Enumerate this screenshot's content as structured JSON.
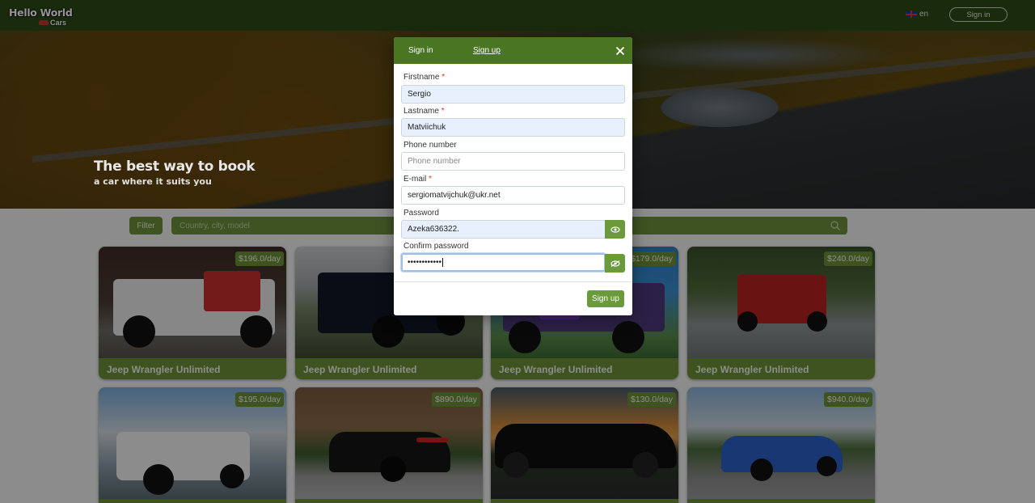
{
  "navbar": {
    "logo_main": "Hello World",
    "logo_sub": "Cars",
    "language": "en",
    "signin_label": "Sign in"
  },
  "hero": {
    "title": "The best way to book",
    "subtitle": "a car where it suits you"
  },
  "filter": {
    "button_label": "Filter",
    "search_placeholder": "Country, city, model"
  },
  "cars": [
    {
      "name": "Jeep Wrangler Unlimited",
      "price": "$196.0/day"
    },
    {
      "name": "Jeep Wrangler Unlimited",
      "price": ""
    },
    {
      "name": "Jeep Wrangler Unlimited",
      "price": "$179.0/day"
    },
    {
      "name": "Jeep Wrangler Unlimited",
      "price": "$240.0/day"
    },
    {
      "name": "",
      "price": "$195.0/day"
    },
    {
      "name": "",
      "price": "$890.0/day"
    },
    {
      "name": "",
      "price": "$130.0/day"
    },
    {
      "name": "",
      "price": "$940.0/day"
    }
  ],
  "modal": {
    "tab_signin": "Sign in",
    "tab_signup": "Sign up",
    "fields": {
      "firstname": {
        "label": "Firstname",
        "value": "Sergio"
      },
      "lastname": {
        "label": "Lastname",
        "value": "Matviichuk"
      },
      "phone": {
        "label": "Phone number",
        "placeholder": "Phone number"
      },
      "email": {
        "label": "E-mail",
        "value": "sergiomatvijchuk@ukr.net"
      },
      "password": {
        "label": "Password",
        "value": "Azeka636322."
      },
      "confirm": {
        "label": "Confirm password",
        "value": "••••••••••••"
      }
    },
    "required_mark": "*",
    "submit_label": "Sign up"
  },
  "colors": {
    "navbar": "#2c4a15",
    "accent": "#6b8f3a",
    "modal_header": "#4a7523",
    "button": "#6b9a3c"
  }
}
